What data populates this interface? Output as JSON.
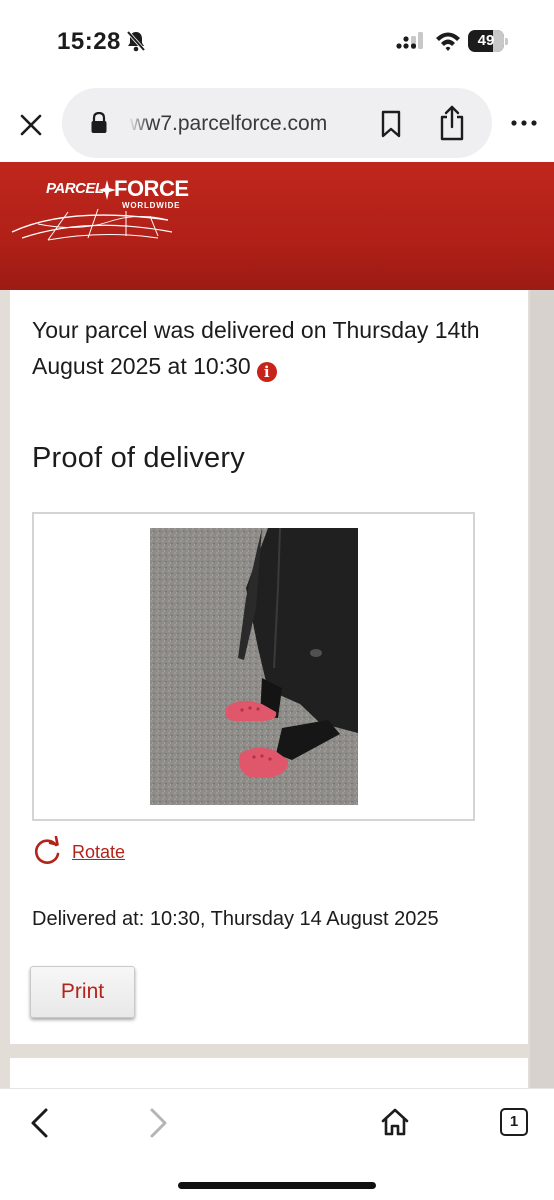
{
  "status_bar": {
    "time": "15:28",
    "battery": "49",
    "icons": [
      "bell-slash-icon",
      "signal-icon",
      "wifi-icon",
      "battery-icon"
    ]
  },
  "browser": {
    "url": "ww7.parcelforce.com",
    "icons": [
      "close-icon",
      "lock-icon",
      "bookmark-icon",
      "share-icon",
      "more-icon"
    ]
  },
  "header": {
    "logo_parcel": "PARCEL",
    "logo_force": "FORCE",
    "logo_worldwide": "WORLDWIDE",
    "colors": {
      "brand": "#b9231a",
      "brand_dark": "#9c1b14"
    }
  },
  "main": {
    "delivered_message": "Your parcel was delivered on Thursday 14th August 2025 at 10:30",
    "info_icon_glyph": "i",
    "proof_heading": "Proof of delivery",
    "rotate_label": "Rotate",
    "delivered_at": "Delivered at: 10:30, Thursday 14 August 2025",
    "print_label": "Print",
    "link_color": "#b2241b"
  },
  "bottom_bar": {
    "tab_count": "1",
    "icons": [
      "back-arrow-icon",
      "forward-arrow-icon",
      "home-icon",
      "tabs-icon"
    ]
  }
}
